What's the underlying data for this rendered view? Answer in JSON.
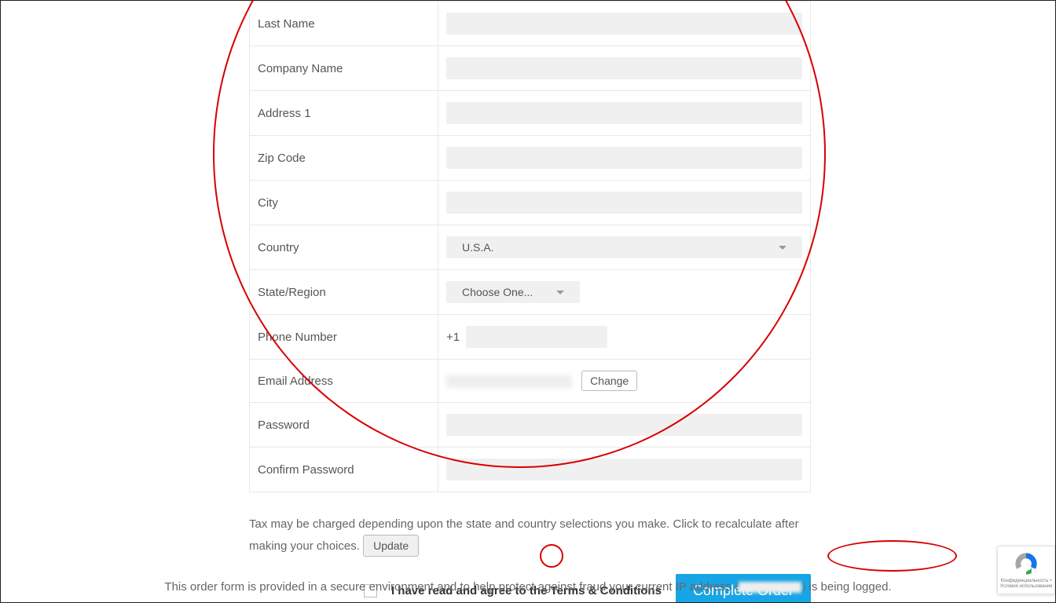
{
  "form": {
    "last_name": {
      "label": "Last Name",
      "value": ""
    },
    "company_name": {
      "label": "Company Name",
      "value": ""
    },
    "address1": {
      "label": "Address 1",
      "value": ""
    },
    "zip": {
      "label": "Zip Code",
      "value": ""
    },
    "city": {
      "label": "City",
      "value": ""
    },
    "country": {
      "label": "Country",
      "value": "U.S.A."
    },
    "state": {
      "label": "State/Region",
      "value": "Choose One..."
    },
    "phone": {
      "label": "Phone Number",
      "prefix": "+1",
      "value": ""
    },
    "email": {
      "label": "Email Address",
      "value": "",
      "change_label": "Change"
    },
    "password": {
      "label": "Password",
      "value": ""
    },
    "confirm_password": {
      "label": "Confirm Password",
      "value": ""
    }
  },
  "tax_note": {
    "text": "Tax may be charged depending upon the state and country selections you make. Click to recalculate after making your choices.",
    "update_label": "Update"
  },
  "agree": {
    "prefix": "I have read and agree to the ",
    "terms_label": "Terms & Conditions"
  },
  "complete_label": "Complete Order",
  "footer": {
    "prefix": "This order form is provided in a secure environment and to help protect against fraud your current IP address (",
    "suffix": ") is being logged."
  },
  "recaptcha": {
    "line1": "Конфиденциальность •",
    "line2": "Условия использования"
  }
}
